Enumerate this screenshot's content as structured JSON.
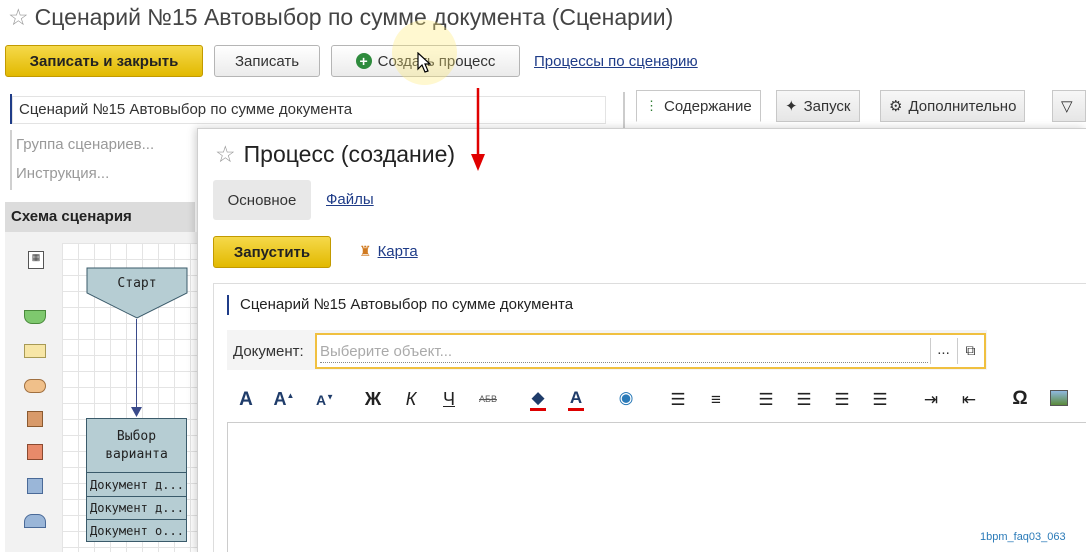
{
  "window": {
    "title": "Сценарий №15 Автовыбор по сумме документа (Сценарии)"
  },
  "toolbar": {
    "save_close": "Записать и закрыть",
    "save": "Записать",
    "create_process": "Создать процесс",
    "processes_link": "Процессы по сценарию"
  },
  "form": {
    "name_value": "Сценарий №15 Автовыбор по сумме документа",
    "group_placeholder": "Группа сценариев...",
    "instruction_placeholder": "Инструкция..."
  },
  "right_tabs": [
    {
      "label": "Содержание"
    },
    {
      "label": "Запуск"
    },
    {
      "label": "Дополнительно"
    }
  ],
  "schema": {
    "header": "Схема сценария",
    "start_label": "Старт",
    "choice_label": "Выбор варианта",
    "options": [
      "Документ д...",
      "Документ д...",
      "Документ о..."
    ]
  },
  "dialog": {
    "title": "Процесс (создание)",
    "tabs": {
      "main": "Основное",
      "files": "Файлы"
    },
    "run_button": "Запустить",
    "map_link": "Карта",
    "scenario_field": "Сценарий №15 Автовыбор по сумме документа",
    "document_label": "Документ:",
    "document_placeholder": "Выберите объект...",
    "select_button": "...",
    "open_button": "⧉"
  },
  "editor_toolbar": {
    "font": "A",
    "font_inc": "A",
    "font_dec": "A",
    "bold": "Ж",
    "italic": "К",
    "underline": "Ч",
    "strike": "АБВ",
    "fg_color": "A",
    "omega": "Ω"
  },
  "watermark": "1bpm_faq03_063",
  "colors": {
    "accent": "#e2b900",
    "link": "#1f3c88",
    "arrow": "#e00000",
    "node_fill": "#b6cdd3"
  }
}
